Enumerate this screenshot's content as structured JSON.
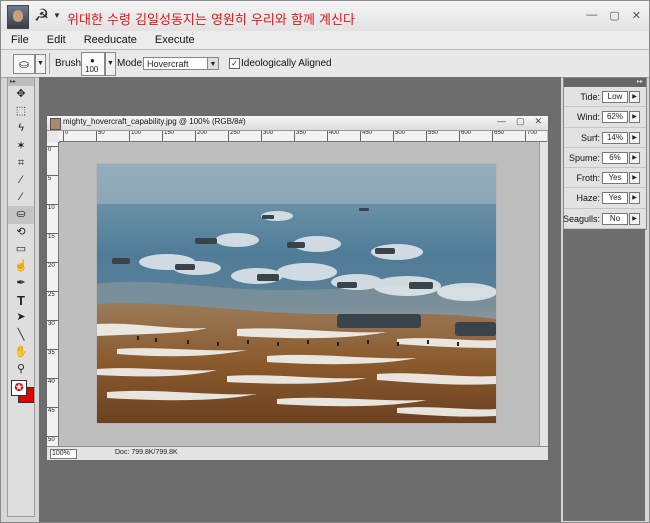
{
  "window": {
    "title": "위대한 수령 김일성동지는 영원히 우리와 함께 계신다",
    "title_color": "#d81a1a",
    "app_glyph": "☭",
    "controls": [
      "—",
      "▢",
      "✕"
    ]
  },
  "menu": [
    "File",
    "Edit",
    "Reeducate",
    "Execute"
  ],
  "options": {
    "brush_label": "Brush:",
    "brush_size": "100",
    "mode_label": "Mode:",
    "mode_value": "Hovercraft",
    "ideological_checked": true,
    "ideological_label": "Ideologically Aligned"
  },
  "document": {
    "title": "mighty_hovercraft_capability.jpg @ 100% (RGB/8#)",
    "zoom": "100%",
    "doc_size": "Doc: 799.8K/799.8K",
    "ruler_top": [
      "0",
      "50",
      "100",
      "150",
      "200",
      "250",
      "300",
      "350",
      "400",
      "450",
      "500",
      "550",
      "600",
      "650",
      "700"
    ],
    "ruler_left": [
      "0",
      "5",
      "10",
      "15",
      "20",
      "25",
      "30",
      "35",
      "40",
      "45",
      "50"
    ]
  },
  "panel": {
    "rows": [
      {
        "label": "Tide:",
        "value": "Low"
      },
      {
        "label": "Wind:",
        "value": "62%"
      },
      {
        "label": "Surf:",
        "value": "14%"
      },
      {
        "label": "Spume:",
        "value": "6%"
      },
      {
        "label": "Froth:",
        "value": "Yes"
      },
      {
        "label": "Haze:",
        "value": "Yes"
      },
      {
        "label": "Seagulls:",
        "value": "No"
      }
    ]
  },
  "tools": [
    "move-tool",
    "marquee-tool",
    "lasso-tool",
    "magic-wand-tool",
    "crop-tool",
    "eyedropper-tool",
    "brush-tool",
    "stamp-tool",
    "eraser-tool",
    "history-brush-tool",
    "smudge-tool",
    "pen-tool",
    "type-tool",
    "path-select-tool",
    "line-tool",
    "hand-tool",
    "zoom-tool"
  ]
}
